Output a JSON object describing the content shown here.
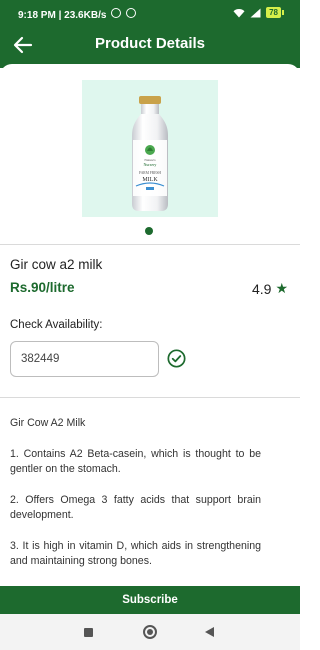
{
  "status_bar": {
    "time": "9:18 PM",
    "network_speed": "23.6KB/s",
    "battery": "78"
  },
  "app_bar": {
    "title": "Product Details",
    "back_icon": "arrow-left-icon"
  },
  "product": {
    "name": "Gir cow a2 milk",
    "price": "Rs.90/litre",
    "rating": "4.9",
    "image_bg_color": "#dff7ee",
    "bottle_label_top": "Nature's",
    "bottle_label_brand": "Nursery",
    "bottle_label_line1": "FARM FRESH",
    "bottle_label_line2": "MILK"
  },
  "availability": {
    "label": "Check Availability:",
    "pincode_value": "382449"
  },
  "description": {
    "title": "Gir Cow A2 Milk",
    "points": [
      "1. Contains A2 Beta-casein, which is thought to be gentler on the stomach.",
      "2. Offers Omega 3 fatty acids that support brain development.",
      "3. It is high in vitamin D, which aids in strengthening and maintaining strong bones."
    ]
  },
  "actions": {
    "subscribe_label": "Subscribe"
  },
  "colors": {
    "brand_green": "#1d6a2e",
    "battery_accent": "#d6ef4a"
  }
}
